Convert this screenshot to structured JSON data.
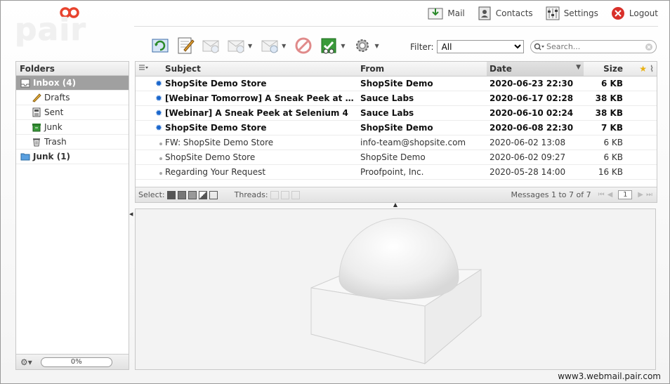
{
  "brand": {
    "logo_text": "pair"
  },
  "topnav": {
    "items": [
      {
        "label": "Mail",
        "icon": "mail-icon"
      },
      {
        "label": "Contacts",
        "icon": "contacts-icon"
      },
      {
        "label": "Settings",
        "icon": "settings-icon"
      },
      {
        "label": "Logout",
        "icon": "logout-icon"
      }
    ]
  },
  "toolbar": {
    "filter_label": "Filter:",
    "filter_value": "All",
    "search_placeholder": "Search..."
  },
  "folders": {
    "header": "Folders",
    "items": [
      {
        "label": "Inbox (4)",
        "icon": "inbox-icon",
        "level": "top",
        "selected": true
      },
      {
        "label": "Drafts",
        "icon": "pencil-icon",
        "level": "sub"
      },
      {
        "label": "Sent",
        "icon": "sent-icon",
        "level": "sub"
      },
      {
        "label": "Junk",
        "icon": "junk-icon",
        "level": "sub"
      },
      {
        "label": "Trash",
        "icon": "trash-icon",
        "level": "sub"
      },
      {
        "label": "Junk (1)",
        "icon": "folder-icon",
        "level": "top"
      }
    ],
    "quota": "0%"
  },
  "messages": {
    "columns": {
      "subject": "Subject",
      "from": "From",
      "date": "Date",
      "size": "Size"
    },
    "rows": [
      {
        "subject": "ShopSite Demo Store",
        "from": "ShopSite Demo",
        "date": "2020-06-23 22:30",
        "size": "6 KB",
        "unread": true
      },
      {
        "subject": "[Webinar Tomorrow] A Sneak Peek at Selenium 4",
        "from": "Sauce Labs",
        "date": "2020-06-17 02:28",
        "size": "38 KB",
        "unread": true
      },
      {
        "subject": "[Webinar] A Sneak Peek at Selenium 4",
        "from": "Sauce Labs",
        "date": "2020-06-10 02:24",
        "size": "38 KB",
        "unread": true
      },
      {
        "subject": "ShopSite Demo Store",
        "from": "ShopSite Demo",
        "date": "2020-06-08 22:30",
        "size": "7 KB",
        "unread": true
      },
      {
        "subject": "FW: ShopSite Demo Store",
        "from": "info-team@shopsite.com",
        "date": "2020-06-02 13:08",
        "size": "6 KB",
        "unread": false
      },
      {
        "subject": "ShopSite Demo Store",
        "from": "ShopSite Demo",
        "date": "2020-06-02 09:27",
        "size": "6 KB",
        "unread": false
      },
      {
        "subject": "Regarding Your Request",
        "from": "Proofpoint, Inc.",
        "date": "2020-05-28 14:00",
        "size": "16 KB",
        "unread": false
      }
    ],
    "footer": {
      "select_label": "Select:",
      "threads_label": "Threads:",
      "count_text": "Messages 1 to 7 of 7",
      "page": "1"
    }
  },
  "host": "www3.webmail.pair.com",
  "colors": {
    "brand_red": "#e8432e",
    "unread_star": "#1a66cc",
    "selected_folder": "#a0a0a0"
  }
}
